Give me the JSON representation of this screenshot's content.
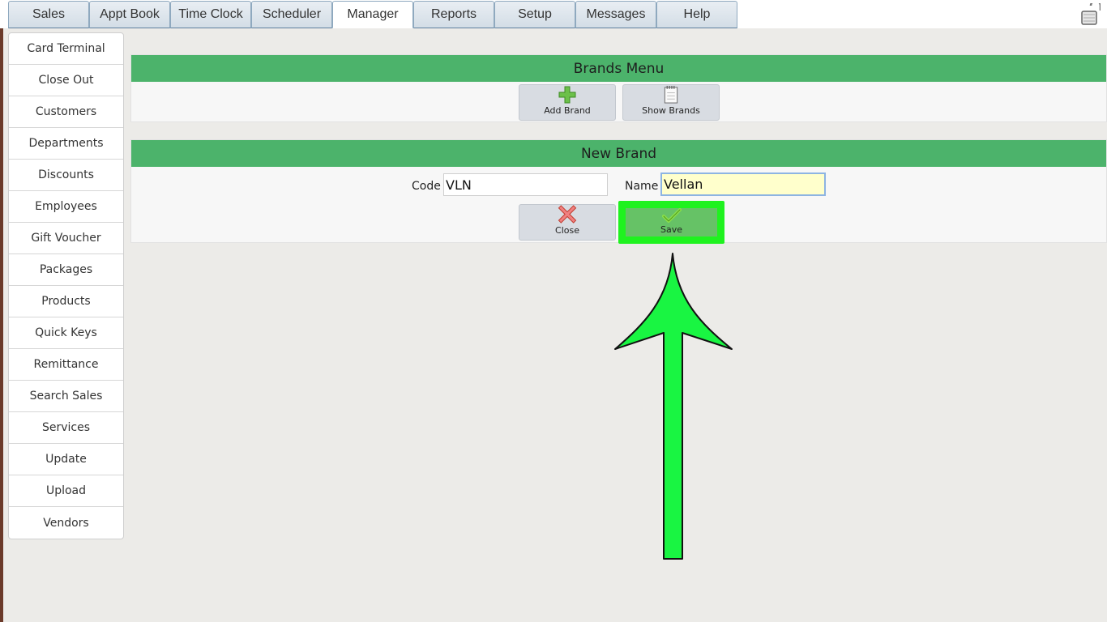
{
  "tabs": [
    {
      "label": "Sales"
    },
    {
      "label": "Appt Book"
    },
    {
      "label": "Time Clock"
    },
    {
      "label": "Scheduler"
    },
    {
      "label": "Manager"
    },
    {
      "label": "Reports"
    },
    {
      "label": "Setup"
    },
    {
      "label": "Messages"
    },
    {
      "label": "Help"
    }
  ],
  "active_tab": "Manager",
  "sidebar": {
    "items": [
      {
        "label": "Card Terminal"
      },
      {
        "label": "Close Out"
      },
      {
        "label": "Customers"
      },
      {
        "label": "Departments"
      },
      {
        "label": "Discounts"
      },
      {
        "label": "Employees"
      },
      {
        "label": "Gift Voucher"
      },
      {
        "label": "Packages"
      },
      {
        "label": "Products"
      },
      {
        "label": "Quick Keys"
      },
      {
        "label": "Remittance"
      },
      {
        "label": "Search Sales"
      },
      {
        "label": "Services"
      },
      {
        "label": "Update"
      },
      {
        "label": "Upload"
      },
      {
        "label": "Vendors"
      }
    ]
  },
  "brands_menu": {
    "title": "Brands Menu",
    "add_label": "Add Brand",
    "show_label": "Show Brands"
  },
  "new_brand": {
    "title": "New Brand",
    "code_label": "Code",
    "code_value": "VLN",
    "name_label": "Name",
    "name_value": "Vellan",
    "close_label": "Close",
    "save_label": "Save"
  },
  "colors": {
    "header_green": "#4cb36b",
    "highlight_green": "#1ff21f",
    "arrow_green": "#19f542"
  }
}
